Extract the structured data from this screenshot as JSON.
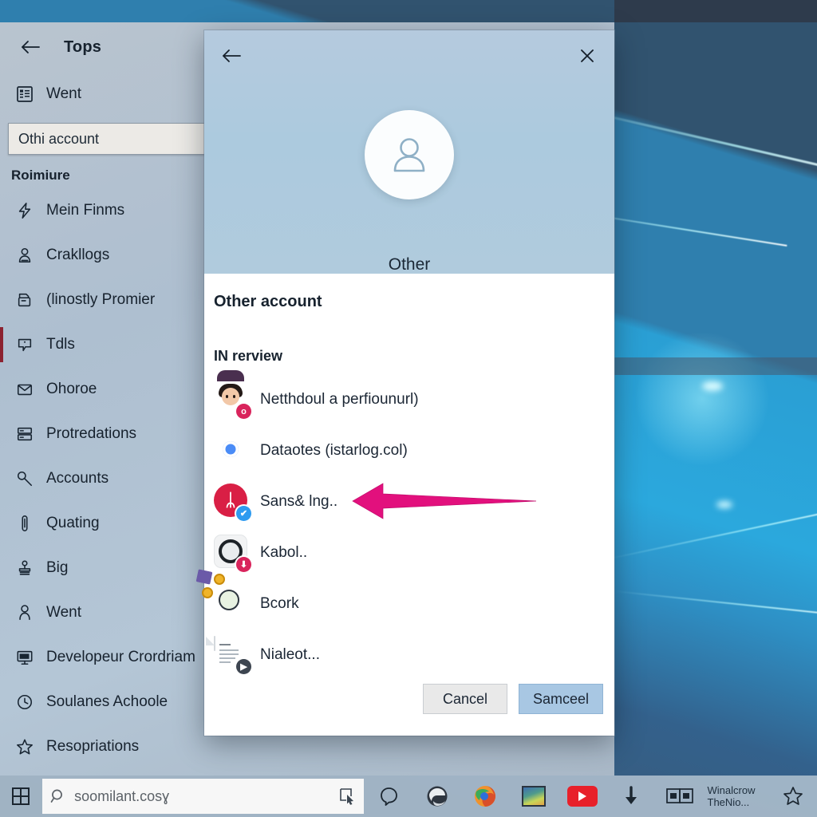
{
  "colors": {
    "accent_arrow": "#e2107d",
    "selected_nav_bar": "#8c2230",
    "primary_button": "#a8c7e3",
    "dialog_hero": "#b0cbdd",
    "settings_chrome": "#b0c0cf",
    "taskbar": "#a8baca"
  },
  "settings_window": {
    "back_label": "Back",
    "title": "Tops",
    "top_item": {
      "icon": "list-icon",
      "label": "Went"
    },
    "search": {
      "value": "Othi account",
      "placeholder": "Othi account"
    },
    "group_header": "Roimiure",
    "nav_items": [
      {
        "icon": "lightning-icon",
        "label": "Mein Finms",
        "selected": false
      },
      {
        "icon": "person-box-icon",
        "label": "Crakllogs",
        "selected": false
      },
      {
        "icon": "printer-icon",
        "label": "(linostly Promier",
        "selected": false
      },
      {
        "icon": "chat-bubble-icon",
        "label": "Tdls",
        "selected": true
      },
      {
        "icon": "mail-icon",
        "label": "Ohoroe",
        "selected": false
      },
      {
        "icon": "server-icon",
        "label": "Protredations",
        "selected": false
      },
      {
        "icon": "key-icon",
        "label": "Accounts",
        "selected": false
      },
      {
        "icon": "thermometer-icon",
        "label": "Quating",
        "selected": false
      },
      {
        "icon": "stamp-icon",
        "label": "Big",
        "selected": false
      },
      {
        "icon": "person-icon",
        "label": "Went",
        "selected": false
      },
      {
        "icon": "monitor-code-icon",
        "label": "Developeur Crordriam",
        "selected": false
      },
      {
        "icon": "clock-icon",
        "label": "Soulanes Achoole",
        "selected": false
      },
      {
        "icon": "star-outline-icon",
        "label": "Resopriations",
        "selected": false
      }
    ]
  },
  "dialog": {
    "back_label": "Back",
    "close_label": "Close",
    "avatar_icon": "person-avatar-icon",
    "hero_name": "Other",
    "heading": "Other account",
    "section_label": "IN rerview",
    "apps": [
      {
        "icon": "avatar-photo-icon",
        "label": "Netthdoul a perfiounurl)",
        "badge": "o",
        "badge_color": "#d9245c"
      },
      {
        "icon": "chrome-icon",
        "label": "Dataotes (istarlog.col)",
        "badge": "",
        "badge_color": ""
      },
      {
        "icon": "bluetooth-icon",
        "label": "Sans& lng..",
        "badge": "✔",
        "badge_color": "#2e9bf0"
      },
      {
        "icon": "camera-icon",
        "label": "Kabol..",
        "badge": "⬇",
        "badge_color": "#d9245c"
      },
      {
        "icon": "doodle-icon",
        "label": "Bcork",
        "badge": "",
        "badge_color": ""
      },
      {
        "icon": "document-icon",
        "label": "Nialeot...",
        "badge": "▶",
        "badge_color": "#3d4550"
      }
    ],
    "cancel_label": "Cancel",
    "confirm_label": "Samceel"
  },
  "annotation": {
    "arrow": "left-pointing-arrow",
    "color": "#e2107d"
  },
  "taskbar": {
    "start_label": "Start",
    "search": {
      "icon": "search-icon",
      "value": "soomilant.cosɣ",
      "placeholder": "soomilant.cosɣ"
    },
    "search_right_icon": "cursor-select-icon",
    "items": [
      {
        "icon": "cortana-icon",
        "label": ""
      },
      {
        "icon": "edge-icon",
        "label": ""
      },
      {
        "icon": "firefox-icon",
        "label": ""
      },
      {
        "icon": "photos-icon",
        "label": ""
      },
      {
        "icon": "youtube-icon",
        "label": ""
      },
      {
        "icon": "download-icon",
        "label": ""
      },
      {
        "icon": "windows-tile-icon",
        "label": ""
      }
    ],
    "tray_text_line1": "Winalcrow",
    "tray_text_line2": "TheNio...",
    "tray_star_icon": "star-outline-icon"
  }
}
